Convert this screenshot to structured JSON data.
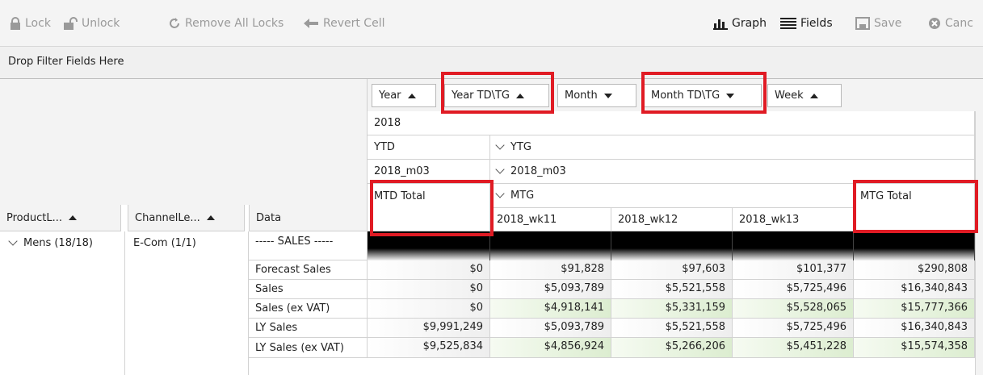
{
  "toolbar": {
    "lock": "Lock",
    "unlock": "Unlock",
    "remove_all_locks": "Remove All Locks",
    "revert_cell": "Revert Cell",
    "graph": "Graph",
    "fields": "Fields",
    "save": "Save",
    "cancel": "Canc"
  },
  "filter_area": {
    "placeholder": "Drop Filter Fields Here"
  },
  "column_fields": [
    "Year",
    "Year TD\\TG",
    "Month",
    "Month TD\\TG",
    "Week"
  ],
  "row_fields": [
    "ProductL...",
    "ChannelLe...",
    "Data"
  ],
  "column_headers": {
    "year": "2018",
    "ytd": "YTD",
    "ytg": "YTG",
    "month_ytd": "2018_m03",
    "month_ytg": "2018_m03",
    "mtd_total": "MTD Total",
    "mtg": "MTG",
    "weeks": [
      "2018_wk11",
      "2018_wk12",
      "2018_wk13"
    ],
    "mtg_total": "MTG Total"
  },
  "row_groups": {
    "product": "Mens (18/18)",
    "channel": "E-Com (1/1)"
  },
  "rows": [
    {
      "label": "----- SALES -----",
      "values": [
        "",
        "",
        "",
        "",
        ""
      ]
    },
    {
      "label": "Forecast Sales",
      "values": [
        "$0",
        "$91,828",
        "$97,603",
        "$101,377",
        "$290,808"
      ]
    },
    {
      "label": "Sales",
      "values": [
        "$0",
        "$5,093,789",
        "$5,521,558",
        "$5,725,496",
        "$16,340,843"
      ]
    },
    {
      "label": "Sales (ex VAT)",
      "values": [
        "$0",
        "$4,918,141",
        "$5,331,159",
        "$5,528,065",
        "$15,777,366"
      ]
    },
    {
      "label": "LY Sales",
      "values": [
        "$9,991,249",
        "$5,093,789",
        "$5,521,558",
        "$5,725,496",
        "$16,340,843"
      ]
    },
    {
      "label": "LY Sales (ex VAT)",
      "values": [
        "$9,525,834",
        "$4,856,924",
        "$5,266,206",
        "$5,451,228",
        "$15,574,358"
      ]
    }
  ],
  "colors": {
    "highlight": "#e01b24",
    "editable_cell": "#dcedd0"
  }
}
